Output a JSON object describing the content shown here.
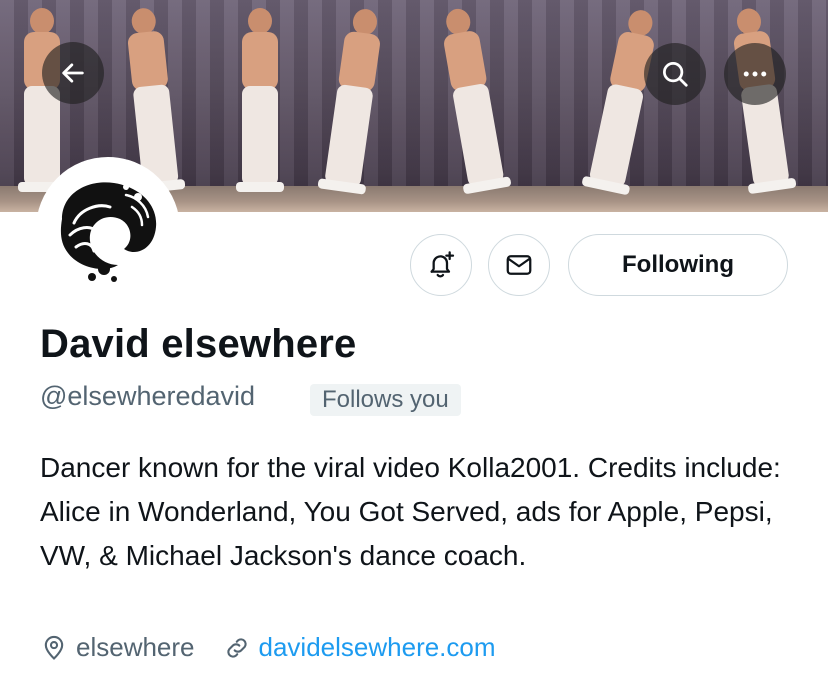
{
  "header": {
    "back_icon": "arrow-left-icon",
    "search_icon": "search-icon",
    "more_icon": "more-horizontal-icon"
  },
  "profile": {
    "name": "David elsewhere",
    "handle": "@elsewheredavid",
    "follows_you_label": "Follows you",
    "bio": "Dancer known for the viral video Kolla2001. Credits include: Alice in Wonderland, You Got Served, ads for Apple, Pepsi, VW, & Michael Jackson's dance coach.",
    "location": "elsewhere",
    "website": "davidelsewhere.com"
  },
  "actions": {
    "notify_icon": "bell-plus-icon",
    "message_icon": "mail-icon",
    "following_label": "Following"
  },
  "colors": {
    "link": "#1d9bf0",
    "secondary_text": "#536471",
    "primary_text": "#0f1419"
  }
}
